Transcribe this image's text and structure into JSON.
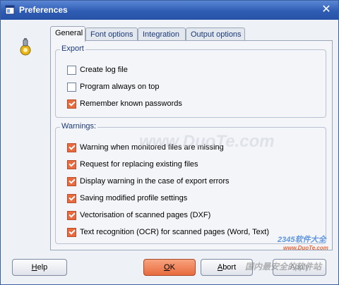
{
  "window": {
    "title": "Preferences",
    "close_glyph": "✕"
  },
  "icons": {
    "app": "preferences-window-icon",
    "side": "gear-lightbulb-icon"
  },
  "tabs": [
    {
      "label": "General",
      "active": true
    },
    {
      "label": "Font options",
      "active": false
    },
    {
      "label": "Integration",
      "active": false
    },
    {
      "label": "Output options",
      "active": false
    }
  ],
  "export_group": {
    "label": "Export",
    "items": [
      {
        "label": "Create log file",
        "checked": false
      },
      {
        "label": "Program always on top",
        "checked": false
      },
      {
        "label": "Remember known passwords",
        "checked": true
      }
    ]
  },
  "warnings_group": {
    "label": "Warnings:",
    "items": [
      {
        "label": "Warning when monitored files are missing",
        "checked": true
      },
      {
        "label": "Request for replacing existing files",
        "checked": true
      },
      {
        "label": "Display warning in the case of export errors",
        "checked": true
      },
      {
        "label": "Saving modified profile settings",
        "checked": true
      },
      {
        "label": "Vectorisation of scanned pages (DXF)",
        "checked": true
      },
      {
        "label": "Text recognition (OCR) for scanned pages (Word, Text)",
        "checked": true
      }
    ]
  },
  "buttons": {
    "help": {
      "accel": "H",
      "rest": "elp"
    },
    "ok": {
      "accel": "O",
      "rest": "K"
    },
    "abort": {
      "accel": "A",
      "rest": "bort"
    },
    "apply": {
      "accel": "",
      "rest": "Apply"
    }
  },
  "colors": {
    "titlebar": "#2f5db4",
    "accent": "#e86b3f"
  },
  "watermarks": {
    "center": "www.DuoTe.com",
    "corner_brand": "2345软件大全",
    "corner_url": "www.DuoTe.com",
    "corner_slogan": "国内最安全的软件站"
  }
}
